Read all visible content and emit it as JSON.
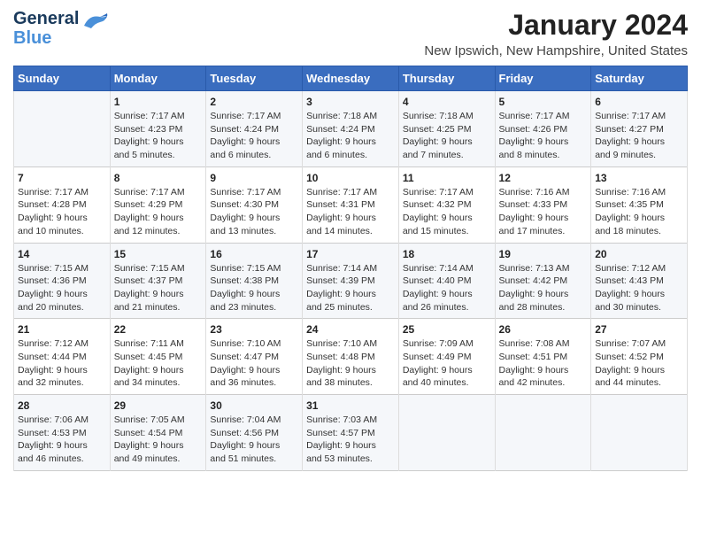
{
  "header": {
    "logo_line1": "General",
    "logo_line2": "Blue",
    "month_title": "January 2024",
    "location": "New Ipswich, New Hampshire, United States"
  },
  "weekdays": [
    "Sunday",
    "Monday",
    "Tuesday",
    "Wednesday",
    "Thursday",
    "Friday",
    "Saturday"
  ],
  "weeks": [
    [
      {
        "day": "",
        "info": ""
      },
      {
        "day": "1",
        "info": "Sunrise: 7:17 AM\nSunset: 4:23 PM\nDaylight: 9 hours\nand 5 minutes."
      },
      {
        "day": "2",
        "info": "Sunrise: 7:17 AM\nSunset: 4:24 PM\nDaylight: 9 hours\nand 6 minutes."
      },
      {
        "day": "3",
        "info": "Sunrise: 7:18 AM\nSunset: 4:24 PM\nDaylight: 9 hours\nand 6 minutes."
      },
      {
        "day": "4",
        "info": "Sunrise: 7:18 AM\nSunset: 4:25 PM\nDaylight: 9 hours\nand 7 minutes."
      },
      {
        "day": "5",
        "info": "Sunrise: 7:17 AM\nSunset: 4:26 PM\nDaylight: 9 hours\nand 8 minutes."
      },
      {
        "day": "6",
        "info": "Sunrise: 7:17 AM\nSunset: 4:27 PM\nDaylight: 9 hours\nand 9 minutes."
      }
    ],
    [
      {
        "day": "7",
        "info": "Sunrise: 7:17 AM\nSunset: 4:28 PM\nDaylight: 9 hours\nand 10 minutes."
      },
      {
        "day": "8",
        "info": "Sunrise: 7:17 AM\nSunset: 4:29 PM\nDaylight: 9 hours\nand 12 minutes."
      },
      {
        "day": "9",
        "info": "Sunrise: 7:17 AM\nSunset: 4:30 PM\nDaylight: 9 hours\nand 13 minutes."
      },
      {
        "day": "10",
        "info": "Sunrise: 7:17 AM\nSunset: 4:31 PM\nDaylight: 9 hours\nand 14 minutes."
      },
      {
        "day": "11",
        "info": "Sunrise: 7:17 AM\nSunset: 4:32 PM\nDaylight: 9 hours\nand 15 minutes."
      },
      {
        "day": "12",
        "info": "Sunrise: 7:16 AM\nSunset: 4:33 PM\nDaylight: 9 hours\nand 17 minutes."
      },
      {
        "day": "13",
        "info": "Sunrise: 7:16 AM\nSunset: 4:35 PM\nDaylight: 9 hours\nand 18 minutes."
      }
    ],
    [
      {
        "day": "14",
        "info": "Sunrise: 7:15 AM\nSunset: 4:36 PM\nDaylight: 9 hours\nand 20 minutes."
      },
      {
        "day": "15",
        "info": "Sunrise: 7:15 AM\nSunset: 4:37 PM\nDaylight: 9 hours\nand 21 minutes."
      },
      {
        "day": "16",
        "info": "Sunrise: 7:15 AM\nSunset: 4:38 PM\nDaylight: 9 hours\nand 23 minutes."
      },
      {
        "day": "17",
        "info": "Sunrise: 7:14 AM\nSunset: 4:39 PM\nDaylight: 9 hours\nand 25 minutes."
      },
      {
        "day": "18",
        "info": "Sunrise: 7:14 AM\nSunset: 4:40 PM\nDaylight: 9 hours\nand 26 minutes."
      },
      {
        "day": "19",
        "info": "Sunrise: 7:13 AM\nSunset: 4:42 PM\nDaylight: 9 hours\nand 28 minutes."
      },
      {
        "day": "20",
        "info": "Sunrise: 7:12 AM\nSunset: 4:43 PM\nDaylight: 9 hours\nand 30 minutes."
      }
    ],
    [
      {
        "day": "21",
        "info": "Sunrise: 7:12 AM\nSunset: 4:44 PM\nDaylight: 9 hours\nand 32 minutes."
      },
      {
        "day": "22",
        "info": "Sunrise: 7:11 AM\nSunset: 4:45 PM\nDaylight: 9 hours\nand 34 minutes."
      },
      {
        "day": "23",
        "info": "Sunrise: 7:10 AM\nSunset: 4:47 PM\nDaylight: 9 hours\nand 36 minutes."
      },
      {
        "day": "24",
        "info": "Sunrise: 7:10 AM\nSunset: 4:48 PM\nDaylight: 9 hours\nand 38 minutes."
      },
      {
        "day": "25",
        "info": "Sunrise: 7:09 AM\nSunset: 4:49 PM\nDaylight: 9 hours\nand 40 minutes."
      },
      {
        "day": "26",
        "info": "Sunrise: 7:08 AM\nSunset: 4:51 PM\nDaylight: 9 hours\nand 42 minutes."
      },
      {
        "day": "27",
        "info": "Sunrise: 7:07 AM\nSunset: 4:52 PM\nDaylight: 9 hours\nand 44 minutes."
      }
    ],
    [
      {
        "day": "28",
        "info": "Sunrise: 7:06 AM\nSunset: 4:53 PM\nDaylight: 9 hours\nand 46 minutes."
      },
      {
        "day": "29",
        "info": "Sunrise: 7:05 AM\nSunset: 4:54 PM\nDaylight: 9 hours\nand 49 minutes."
      },
      {
        "day": "30",
        "info": "Sunrise: 7:04 AM\nSunset: 4:56 PM\nDaylight: 9 hours\nand 51 minutes."
      },
      {
        "day": "31",
        "info": "Sunrise: 7:03 AM\nSunset: 4:57 PM\nDaylight: 9 hours\nand 53 minutes."
      },
      {
        "day": "",
        "info": ""
      },
      {
        "day": "",
        "info": ""
      },
      {
        "day": "",
        "info": ""
      }
    ]
  ]
}
